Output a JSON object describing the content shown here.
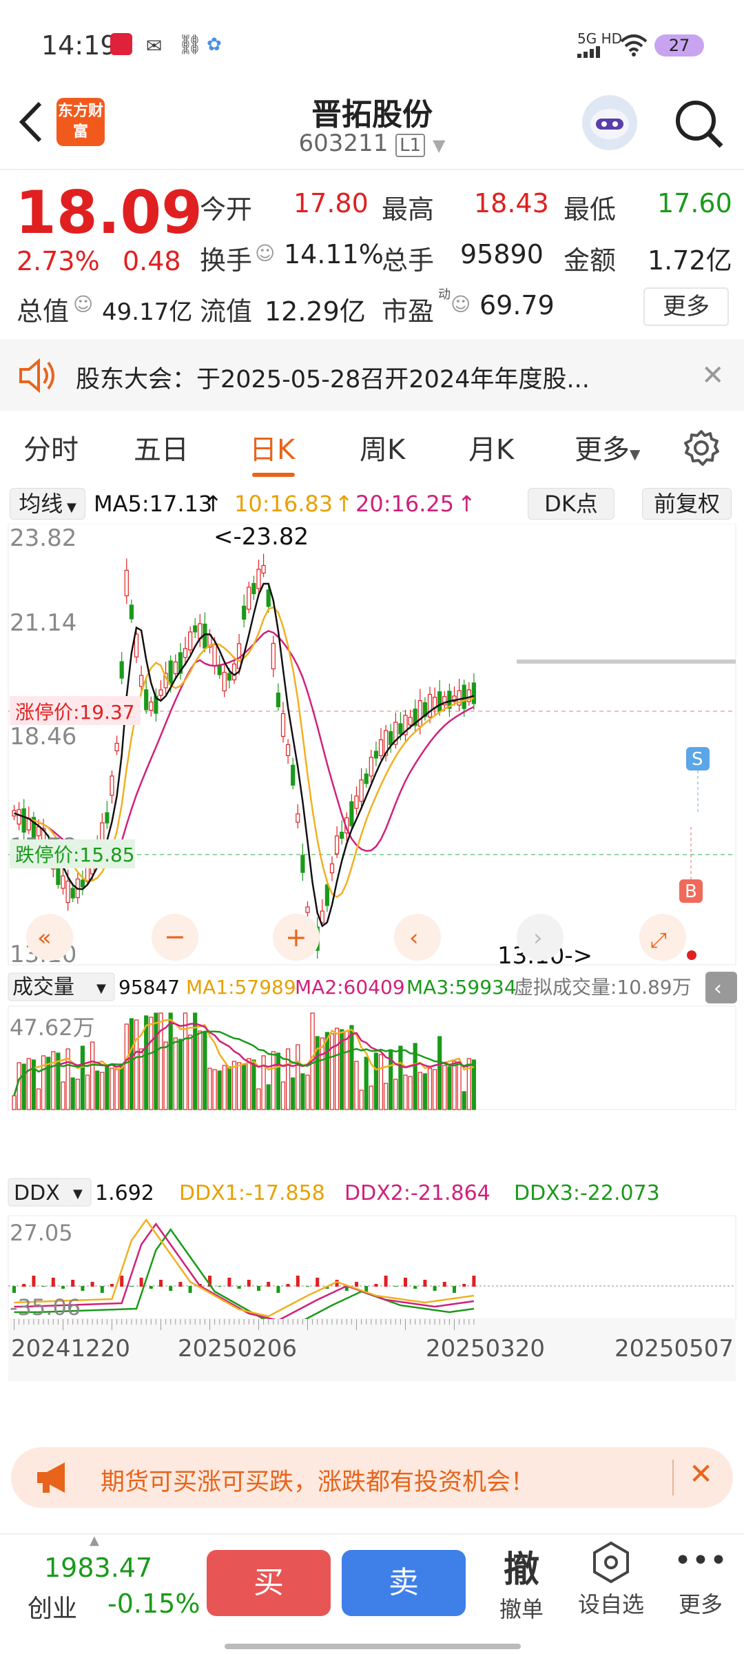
{
  "status_bar": {
    "time": "14:19",
    "network": "5G HD",
    "battery": "27"
  },
  "header": {
    "logo_text": "东方财富",
    "title": "晋拓股份",
    "code": "603211",
    "level": "L1"
  },
  "quote": {
    "price": "18.09",
    "change_pct": "2.73%",
    "change": "0.48",
    "open_label": "今开",
    "open": "17.80",
    "high_label": "最高",
    "high": "18.43",
    "low_label": "最低",
    "low": "17.60",
    "turnover_label": "换手",
    "turnover": "14.11%",
    "volume_label": "总手",
    "volume": "95890",
    "amount_label": "金额",
    "amount": "1.72亿",
    "mktcap_label": "总值",
    "mktcap": "49.17亿",
    "float_label": "流值",
    "float": "12.29亿",
    "pe_label": "市盈",
    "pe_sup": "动",
    "pe": "69.79",
    "more_label": "更多"
  },
  "notice": {
    "text": "股东大会：于2025-05-28召开2024年年度股..."
  },
  "tabs": [
    {
      "label": "分时"
    },
    {
      "label": "五日"
    },
    {
      "label": "日K",
      "active": true
    },
    {
      "label": "周K"
    },
    {
      "label": "月K"
    },
    {
      "label": "更多"
    }
  ],
  "kline_header": {
    "indicator": "均线",
    "ma5": "MA5:17.13",
    "ma10": "10:16.83",
    "ma20": "20:16.25",
    "dk": "DK点",
    "adjust": "前复权"
  },
  "kline": {
    "y_labels": [
      "23.82",
      "21.14",
      "18.46",
      "15.78",
      "13.10"
    ],
    "limit_up": "涨停价:19.37",
    "limit_down": "跌停价:15.85",
    "max_label": "<-23.82",
    "min_label": "13.10->",
    "markers": {
      "s": "S",
      "b": "B"
    }
  },
  "volume_header": {
    "indicator": "成交量",
    "vol": "95847",
    "ma1": "MA1:57989",
    "ma2": "MA2:60409",
    "ma3": "MA3:59934",
    "virtual": "虚拟成交量:10.89万"
  },
  "volume": {
    "y_max": "47.62万"
  },
  "ddx_header": {
    "indicator": "DDX",
    "ddx": "1.692",
    "ddx1": "DDX1:-17.858",
    "ddx2": "DDX2:-21.864",
    "ddx3": "DDX3:-22.073"
  },
  "ddx": {
    "y_max": "27.05",
    "y_min": "-35.06"
  },
  "dates": [
    "20241220",
    "20250206",
    "20250320",
    "20250507"
  ],
  "ad": {
    "text": "期货可买涨可买跌，涨跌都有投资机会！"
  },
  "bottom": {
    "index_value": "1983.47",
    "index_name": "创业",
    "index_change": "-0.15%",
    "buy": "买",
    "sell": "卖",
    "cancel_icon_char": "撤",
    "cancel": "撤单",
    "watch": "设自选",
    "more": "更多"
  },
  "colors": {
    "up": "#e02020",
    "down": "#1a9a1a",
    "ma5": "#111111",
    "ma10": "#f0b020",
    "ma20": "#d0207a",
    "accent": "#e8641b",
    "buy": "#e85555",
    "sell": "#3f7fe8"
  }
}
